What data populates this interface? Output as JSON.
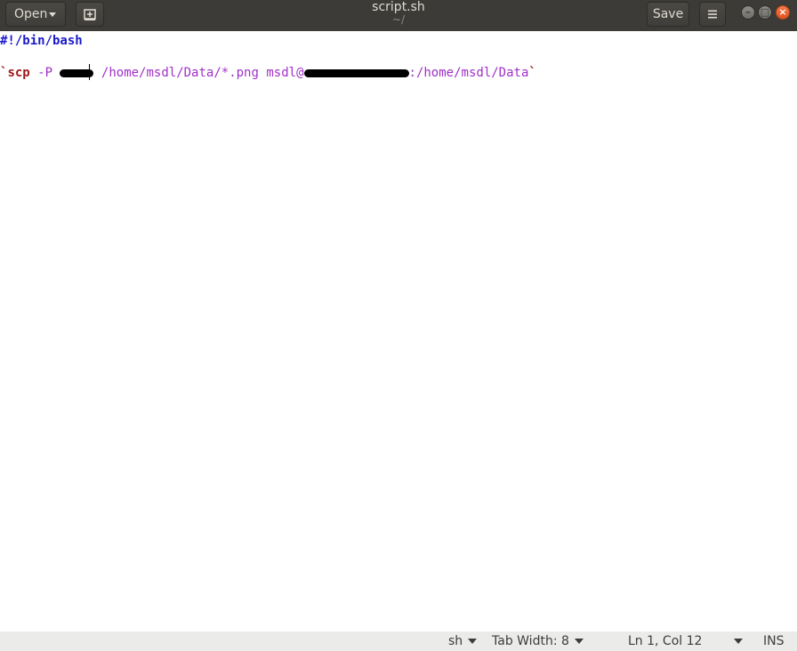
{
  "window": {
    "title": "script.sh",
    "subtitle": "~/"
  },
  "header": {
    "open_label": "Open",
    "new_doc_icon": "new-document-icon",
    "save_label": "Save",
    "menu_icon": "hamburger-menu-icon",
    "window_buttons": [
      "minimize",
      "maximize",
      "close"
    ]
  },
  "editor": {
    "line1": "#!/bin/bash",
    "line3": {
      "open_tick": "`",
      "command": "scp",
      "flag": "-P",
      "source": "/home/msdl/Data/*.png",
      "user": "msdl@",
      "dest_path": ":/home/msdl/Data",
      "close_tick": "`"
    }
  },
  "statusbar": {
    "language": "sh",
    "tab_width": "Tab Width: 8",
    "position": "Ln 1, Col 12",
    "mode": "INS"
  },
  "colors": {
    "headerbar": "#3c3b37",
    "shebang": "#1a1acc",
    "command": "#a01818",
    "string": "#a030c8",
    "close_button": "#e95420"
  }
}
